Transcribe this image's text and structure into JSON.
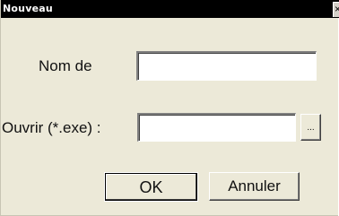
{
  "window": {
    "title": "Nouveau",
    "close_glyph": "×",
    "close_icon": "close-icon"
  },
  "form": {
    "name_label": "Nom de",
    "name_value": "",
    "open_label": "Ouvrir (*.exe) :",
    "open_value": "",
    "browse_label": "..."
  },
  "buttons": {
    "ok_label": "OK",
    "cancel_label": "Annuler"
  },
  "colors": {
    "titlebar": "#000000",
    "title_text": "#ffffff",
    "dialog_background": "#ece9d8",
    "field_background": "#ffffff"
  }
}
